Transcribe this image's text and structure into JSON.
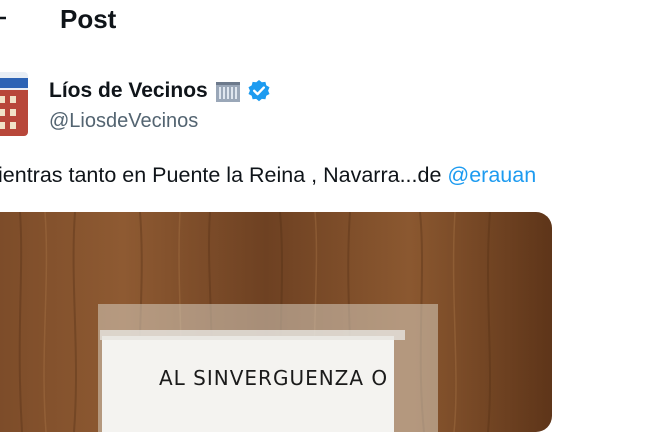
{
  "header": {
    "title": "Post"
  },
  "author": {
    "display_name": "Líos de Vecinos",
    "handle": "@LiosdeVecinos",
    "verified": true
  },
  "post": {
    "text": "ientras tanto en Puente la Reina , Navarra...de ",
    "mention": "@erauan"
  },
  "media": {
    "note_text": "AL SINVERGUENZA O"
  },
  "icons": {
    "back": "back-arrow-icon",
    "building": "building-emoji-icon",
    "verified": "verified-badge-icon"
  },
  "colors": {
    "verified": "#1d9bf0",
    "mention": "#1d9bf0",
    "secondary_text": "#536471"
  }
}
